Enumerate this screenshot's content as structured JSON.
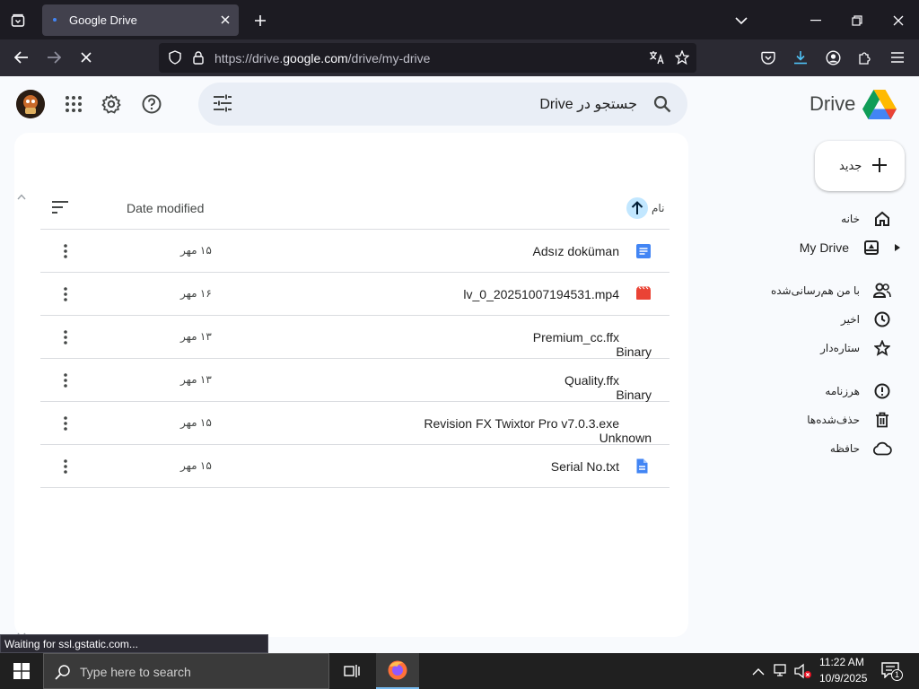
{
  "browser": {
    "tab_title": "Google Drive",
    "url_prefix": "https://drive.",
    "url_domain": "google.com",
    "url_path": "/drive/my-drive",
    "status_text": "Waiting for ssl.gstatic.com..."
  },
  "drive": {
    "logo_text": "Drive",
    "search_placeholder": "جستجو در Drive",
    "new_button": "جدید",
    "nav": [
      {
        "label": "خانه",
        "icon": "home-icon"
      },
      {
        "label": "My Drive",
        "icon": "my-drive-icon"
      },
      {
        "label": "با من هم‌رسانی‌شده",
        "icon": "shared-icon"
      },
      {
        "label": "اخیر",
        "icon": "clock-icon"
      },
      {
        "label": "ستاره‌دار",
        "icon": "star-icon"
      },
      {
        "label": "هرزنامه",
        "icon": "spam-icon"
      },
      {
        "label": "حذف‌شده‌ها",
        "icon": "trash-icon"
      },
      {
        "label": "حافظه",
        "icon": "cloud-icon"
      }
    ],
    "columns": {
      "name": "نام",
      "date": "Date modified"
    },
    "files": [
      {
        "name": "Adsız doküman",
        "sub": "",
        "date": "۱۵ مهر",
        "type": "doc",
        "color": "#4285f4"
      },
      {
        "name": "lv_0_20251007194531.mp4",
        "sub": "",
        "date": "۱۶ مهر",
        "type": "video",
        "color": "#ea4335"
      },
      {
        "name": "Premium_cc.ffx",
        "sub": "Binary",
        "date": "۱۳ مهر",
        "type": "none",
        "color": ""
      },
      {
        "name": "Quality.ffx",
        "sub": "Binary",
        "date": "۱۳ مهر",
        "type": "none",
        "color": ""
      },
      {
        "name": "Revision FX Twixtor Pro v7.0.3.exe",
        "sub": "Unknown",
        "date": "۱۵ مهر",
        "type": "none",
        "color": ""
      },
      {
        "name": "Serial No.txt",
        "sub": "",
        "date": "۱۵ مهر",
        "type": "file",
        "color": "#4285f4"
      }
    ]
  },
  "taskbar": {
    "search_placeholder": "Type here to search",
    "time": "11:22 AM",
    "date": "10/9/2025",
    "notification_count": "1"
  }
}
